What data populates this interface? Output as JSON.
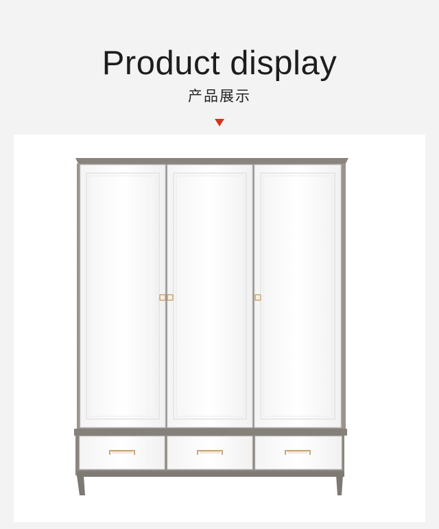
{
  "header": {
    "title": "Product display",
    "subtitle": "产品展示",
    "arrow_icon": "triangle-down-icon",
    "arrow_color": "#d4331f"
  },
  "product": {
    "image_subject": "three-door wardrobe with three drawers",
    "frame_color": "#8f8983",
    "panel_color": "#ffffff",
    "handle_color": "#c9a47a"
  }
}
